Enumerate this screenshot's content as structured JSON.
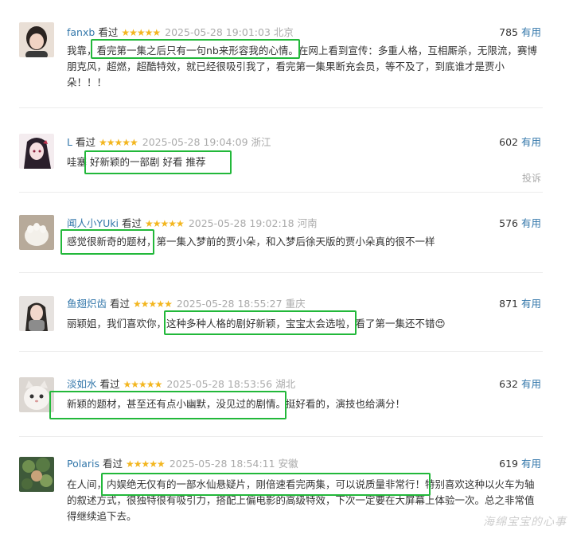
{
  "comments": [
    {
      "user": "fanxb",
      "status": "看过",
      "stars": "★★★★★",
      "time": "2025-05-28 19:01:03",
      "location": "北京",
      "votes": "785",
      "useful": "有用",
      "text": "我靠，看完第一集之后只有一句nb来形容我的心情。在网上看到宣传：多重人格，互相厮杀，无限流，赛博朋克风，超燃，超酷特效，就已经很吸引我了，看完第一集果断充会员，等不及了，到底谁才是贾小朵！！！",
      "highlight": "看完第一集之后只有一句nb来形容我的心情。",
      "avatar": "person-avatar"
    },
    {
      "user": "L",
      "status": "看过",
      "stars": "★★★★★",
      "time": "2025-05-28 19:04:09",
      "location": "浙江",
      "votes": "602",
      "useful": "有用",
      "text": "哇塞 好新颖的一部剧 好看 推荐",
      "highlight": "好新颖的一部剧 好看 推荐",
      "report": "投诉",
      "avatar": "anime-avatar"
    },
    {
      "user": "闻人小YUki",
      "status": "看过",
      "stars": "★★★★★",
      "time": "2025-05-28 19:02:18",
      "location": "河南",
      "votes": "576",
      "useful": "有用",
      "text": "感觉很新奇的题材，第一集入梦前的贾小朵，和入梦后徐天版的贾小朵真的很不一样",
      "highlight": "感觉很新奇的题材",
      "avatar": "cat-paw-avatar"
    },
    {
      "user": "鱼翅炽齿",
      "status": "看过",
      "stars": "★★★★★",
      "time": "2025-05-28 18:55:27",
      "location": "重庆",
      "votes": "871",
      "useful": "有用",
      "text": "丽颖姐，我们喜欢你，这种多种人格的剧好新颖，宝宝太会选啦，看了第一集还不错😍",
      "highlight": "这种多种人格的剧好新颖，宝宝太会选啦，",
      "avatar": "girl-avatar"
    },
    {
      "user": "淡如水",
      "status": "看过",
      "stars": "★★★★★",
      "time": "2025-05-28 18:53:56",
      "location": "湖北",
      "votes": "632",
      "useful": "有用",
      "text": "新颖的题材，甚至还有点小幽默，没见过的剧情。挺好看的，演技也给满分！",
      "highlight": "新颖的题材，甚至还有点小幽默，没见过的剧情。",
      "avatar": "cat-avatar"
    },
    {
      "user": "Polaris",
      "status": "看过",
      "stars": "★★★★★",
      "time": "2025-05-28 18:54:11",
      "location": "安徽",
      "votes": "619",
      "useful": "有用",
      "text": "在人间，内娱绝无仅有的一部水仙悬疑片，刚倍速看完两集，可以说质量非常行！特别喜欢这种以火车为轴的叙述方式，很独特很有吸引力，搭配上偏电影的高级特效，下次一定要在大屏幕上体验一次。总之非常值得继续追下去。",
      "highlight": "内娱绝无仅有的一部水仙悬疑片，刚倍速看完两集，可以说质量非常行！",
      "avatar": "plant-avatar"
    }
  ],
  "watermark": "海绵宝宝的心事",
  "colors": {
    "link": "#3377aa",
    "star": "#f3b61f",
    "highlight": "#22b83a",
    "muted": "#aaaaaa"
  }
}
